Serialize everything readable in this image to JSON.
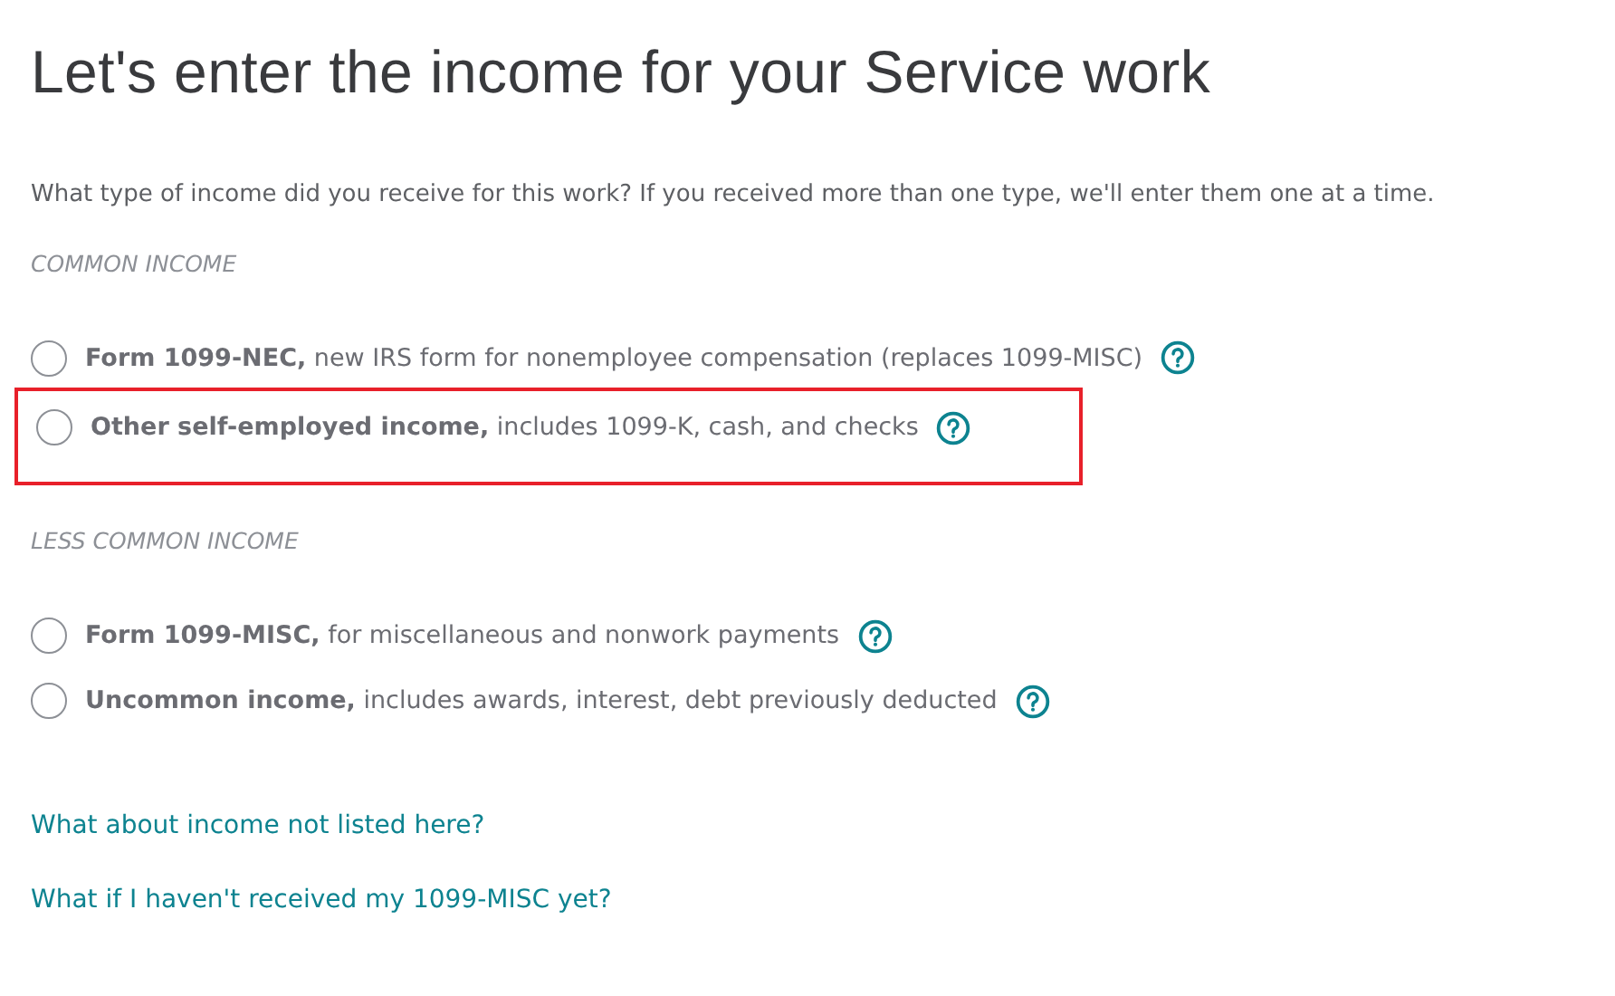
{
  "title": "Let's enter the income for your Service work",
  "intro": "What type of income did you receive for this work? If you received more than one type, we'll enter them one at a time.",
  "sections": [
    {
      "heading": "COMMON INCOME",
      "options": [
        {
          "label": "**Form 1099-NEC,** new IRS form for nonemployee compensation (replaces 1099-MISC)",
          "selected": false,
          "highlighted": false
        },
        {
          "label": "**Other self-employed income,** includes 1099-K, cash, and checks",
          "selected": false,
          "highlighted": true
        }
      ]
    },
    {
      "heading": "LESS COMMON INCOME",
      "options": [
        {
          "label": "**Form 1099-MISC,** for miscellaneous and nonwork payments",
          "selected": false,
          "highlighted": false
        },
        {
          "label": "**Uncommon income,** includes awards, interest, debt previously deducted",
          "selected": false,
          "highlighted": false
        }
      ]
    }
  ],
  "links": [
    "What about income not listed here?",
    "What if I haven't received my 1099-MISC yet?"
  ]
}
